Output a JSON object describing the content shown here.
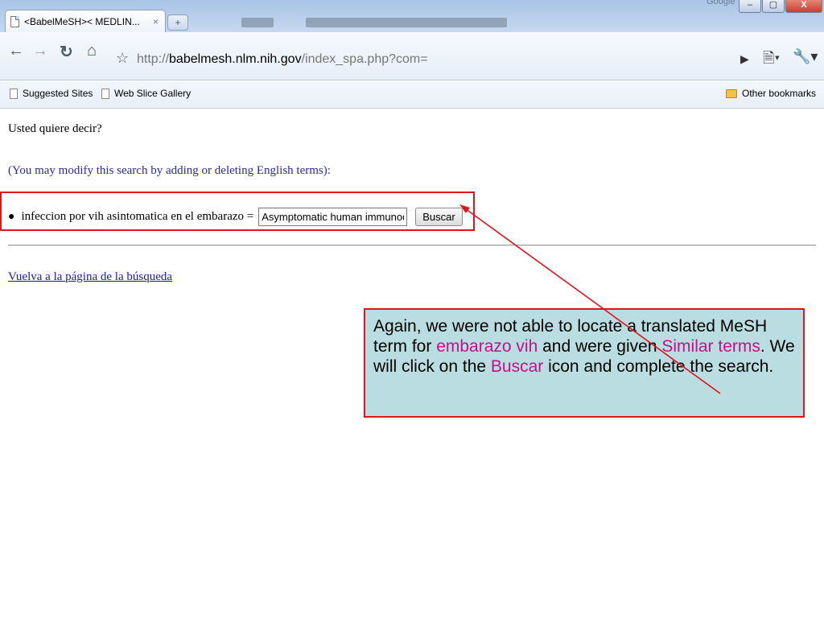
{
  "browser": {
    "tab_title": "<BabelMeSH>< MEDLIN...",
    "tab_close": "×",
    "new_tab": "+",
    "google_label": "Google",
    "window_buttons": [
      "–",
      "▢",
      "X"
    ],
    "url_prefix": "http://",
    "url_host": "babelmesh.nlm.nih.gov",
    "url_path": "/index_spa.php?com=",
    "bookmarks": [
      "Suggested Sites",
      "Web Slice Gallery"
    ],
    "other_bookmarks": "Other bookmarks"
  },
  "page": {
    "question": "Usted quiere decir?",
    "instruction": "(You may modify this search by adding or deleting English terms):",
    "term_label": "infeccion por vih asintomatica en el embarazo =",
    "term_value": "Asymptomatic human immunodeficiency virus infection pregnancy",
    "search_button": "Buscar",
    "back_link": "Vuelva a la página de la búsqueda"
  },
  "callout": {
    "part1": "Again, we were not able to locate a translated MeSH term for ",
    "hl1": "embarazo vih",
    "part2": " and were given ",
    "hl2": "Similar terms",
    "part3": ".  We will click on the ",
    "hl3": "Buscar",
    "part4": " icon and complete the search."
  },
  "colors": {
    "highlight": "#c0128a",
    "annotation_red": "#e0141c",
    "callout_bg": "#b9dde0"
  }
}
